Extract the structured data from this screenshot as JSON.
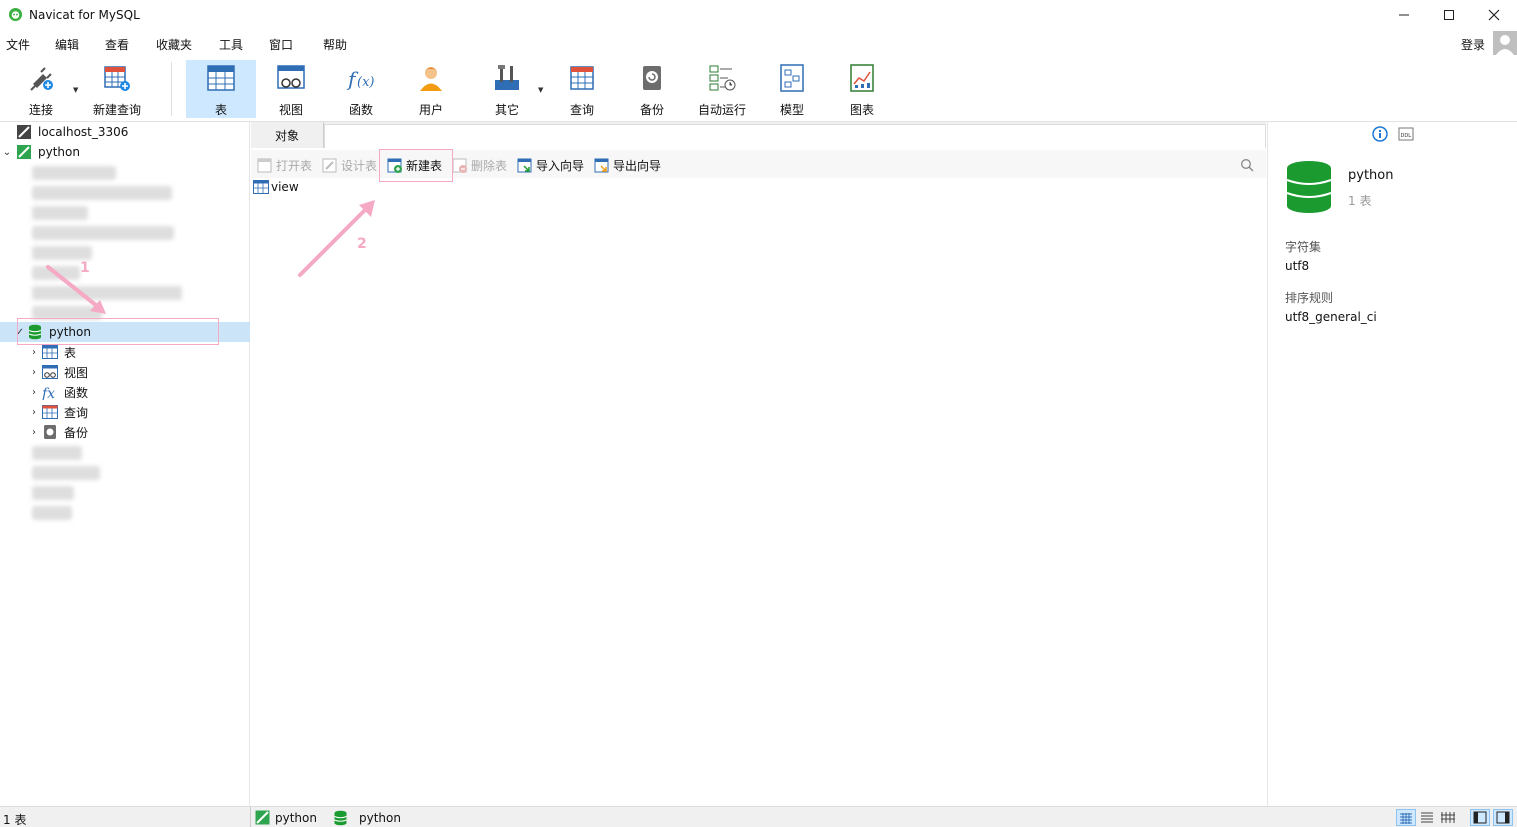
{
  "window": {
    "title": "Navicat for MySQL"
  },
  "menu": [
    "文件",
    "编辑",
    "查看",
    "收藏夹",
    "工具",
    "窗口",
    "帮助"
  ],
  "account": {
    "login": "登录"
  },
  "toolbar": {
    "connect": "连接",
    "new_query": "新建查询",
    "table": "表",
    "view": "视图",
    "function": "函数",
    "user": "用户",
    "other": "其它",
    "query": "查询",
    "backup": "备份",
    "autorun": "自动运行",
    "model": "模型",
    "chart": "图表"
  },
  "tree": {
    "connection_1": "localhost_3306",
    "connection_2": "python",
    "selected_db": "python",
    "children": [
      "表",
      "视图",
      "函数",
      "查询",
      "备份"
    ]
  },
  "center": {
    "tab": "对象",
    "actions": {
      "open": "打开表",
      "design": "设计表",
      "new": "新建表",
      "delete": "删除表",
      "import": "导入向导",
      "export": "导出向导"
    },
    "objects": [
      "view"
    ]
  },
  "annotations": {
    "n1": "1",
    "n2": "2"
  },
  "info": {
    "name": "python",
    "count": "1 表",
    "charset_label": "字符集",
    "charset_value": "utf8",
    "collation_label": "排序规则",
    "collation_value": "utf8_general_ci"
  },
  "status": {
    "count": "1 表",
    "connection": "python",
    "database": "python"
  },
  "colors": {
    "accent": "#0078d7",
    "selection": "#cce4f7",
    "db_green": "#1a9a2f",
    "annotation": "#f5a9c4"
  }
}
